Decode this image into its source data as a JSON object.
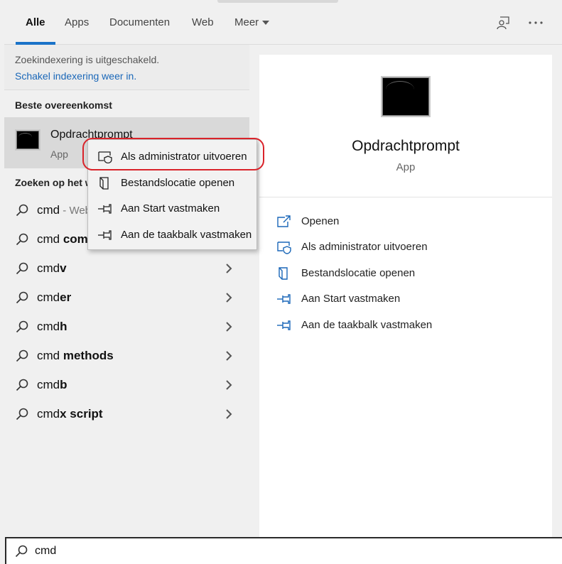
{
  "tabs": [
    {
      "label": "Alle",
      "active": true
    },
    {
      "label": "Apps",
      "active": false
    },
    {
      "label": "Documenten",
      "active": false
    },
    {
      "label": "Web",
      "active": false
    },
    {
      "label": "Meer",
      "active": false
    }
  ],
  "top_icons": [
    "feedback-icon",
    "more-icon"
  ],
  "notice": {
    "line1": "Zoekindexering is uitgeschakeld.",
    "link": "Schakel indexering weer in."
  },
  "best_match": {
    "heading": "Beste overeenkomst",
    "name": "Opdrachtprompt",
    "type": "App"
  },
  "web_search": {
    "heading": "Zoeken op het web",
    "suggestions": [
      {
        "prefix": "cmd",
        "bold": "",
        "suffix": " - Web"
      },
      {
        "prefix": "cmd",
        "bold": " com",
        "suffix": ""
      },
      {
        "prefix": "cmd",
        "bold": "v",
        "suffix": ""
      },
      {
        "prefix": "cmd",
        "bold": "er",
        "suffix": ""
      },
      {
        "prefix": "cmd",
        "bold": "h",
        "suffix": ""
      },
      {
        "prefix": "cmd",
        "bold": " methods",
        "suffix": ""
      },
      {
        "prefix": "cmd",
        "bold": "b",
        "suffix": ""
      },
      {
        "prefix": "cmd",
        "bold": "x script",
        "suffix": ""
      }
    ]
  },
  "context_menu": [
    {
      "label": "Als administrator uitvoeren",
      "icon": "shield-icon"
    },
    {
      "label": "Bestandslocatie openen",
      "icon": "file-location-icon"
    },
    {
      "label": "Aan Start vastmaken",
      "icon": "pin-icon"
    },
    {
      "label": "Aan de taakbalk vastmaken",
      "icon": "pin-icon"
    }
  ],
  "preview": {
    "title": "Opdrachtprompt",
    "type": "App",
    "actions": [
      {
        "label": "Openen",
        "icon": "open-icon"
      },
      {
        "label": "Als administrator uitvoeren",
        "icon": "shield-icon"
      },
      {
        "label": "Bestandslocatie openen",
        "icon": "file-location-icon"
      },
      {
        "label": "Aan Start vastmaken",
        "icon": "pin-icon"
      },
      {
        "label": "Aan de taakbalk vastmaken",
        "icon": "pin-icon"
      }
    ]
  },
  "search": {
    "value": "cmd"
  },
  "colors": {
    "accent": "#1a73c8",
    "highlight_ring": "#d9232a",
    "link": "#1a67b8"
  }
}
